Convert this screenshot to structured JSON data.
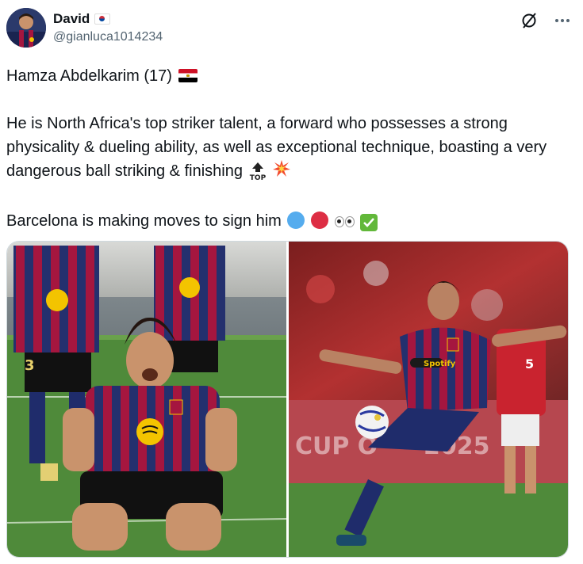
{
  "author": {
    "display_name": "David",
    "handle": "@gianluca1014234",
    "flag_icon": "south-korea-flag-icon"
  },
  "actions": {
    "grok_icon": "grok-slash-circle-icon",
    "more_icon": "more-horizontal-icon"
  },
  "tweet": {
    "line1_text": "Hamza Abdelkarim (17)",
    "line2_text": "He is North Africa's top striker talent, a forward who possesses a strong physicality & dueling ability, as well as exceptional technique, boasting a very dangerous ball striking & finishing",
    "line3_text": "Barcelona is making moves to sign him",
    "emoji": {
      "flag": "egypt-flag-icon",
      "top": "top-arrow-icon",
      "collision": "collision-icon",
      "blue": "blue-circle-icon",
      "red": "red-circle-icon",
      "eyes": "eyes-icon",
      "check": "check-mark-button-icon"
    },
    "top_label": "TOP"
  },
  "media": {
    "photo1": {
      "icon": "photo-celebration",
      "sponsor_text": "",
      "number": "3"
    },
    "photo2": {
      "icon": "photo-volley",
      "sponsor_text": "Spotify",
      "banner_left": "CUP O",
      "banner_right": "2025",
      "opponent_number": "5"
    }
  },
  "colors": {
    "text_primary": "#0f1419",
    "text_secondary": "#536471",
    "border": "#cfd9de",
    "barca_blue": "#1f2c6b",
    "barca_red": "#a5163f",
    "pitch": "#4f8a3a"
  }
}
